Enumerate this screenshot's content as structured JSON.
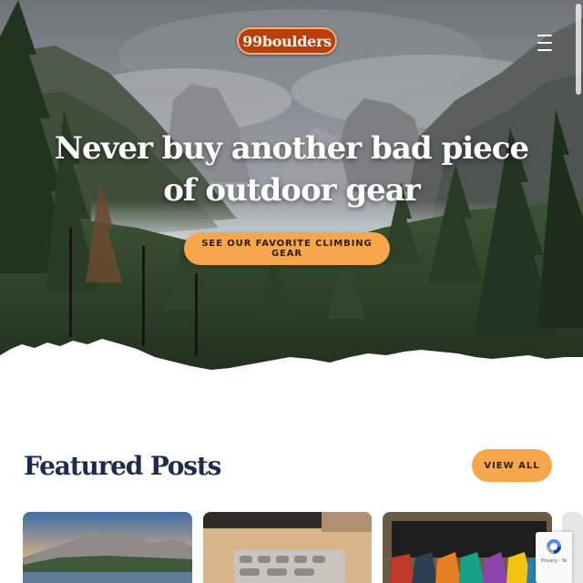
{
  "brand": {
    "logo_text": "99boulders"
  },
  "hero": {
    "title": "Never buy another bad piece of outdoor gear",
    "cta_label": "SEE OUR FAVORITE CLIMBING GEAR"
  },
  "featured": {
    "title": "Featured Posts",
    "view_all_label": "VIEW ALL"
  },
  "recaptcha": {
    "fine_print": "Privacy - Te"
  },
  "icons": {
    "menu": "hamburger-menu-icon",
    "recaptcha": "recaptcha-logo-icon"
  },
  "colors": {
    "accent": "#f7a64c",
    "heading": "#1d2b4f",
    "logo_bg": "#b8400f"
  }
}
